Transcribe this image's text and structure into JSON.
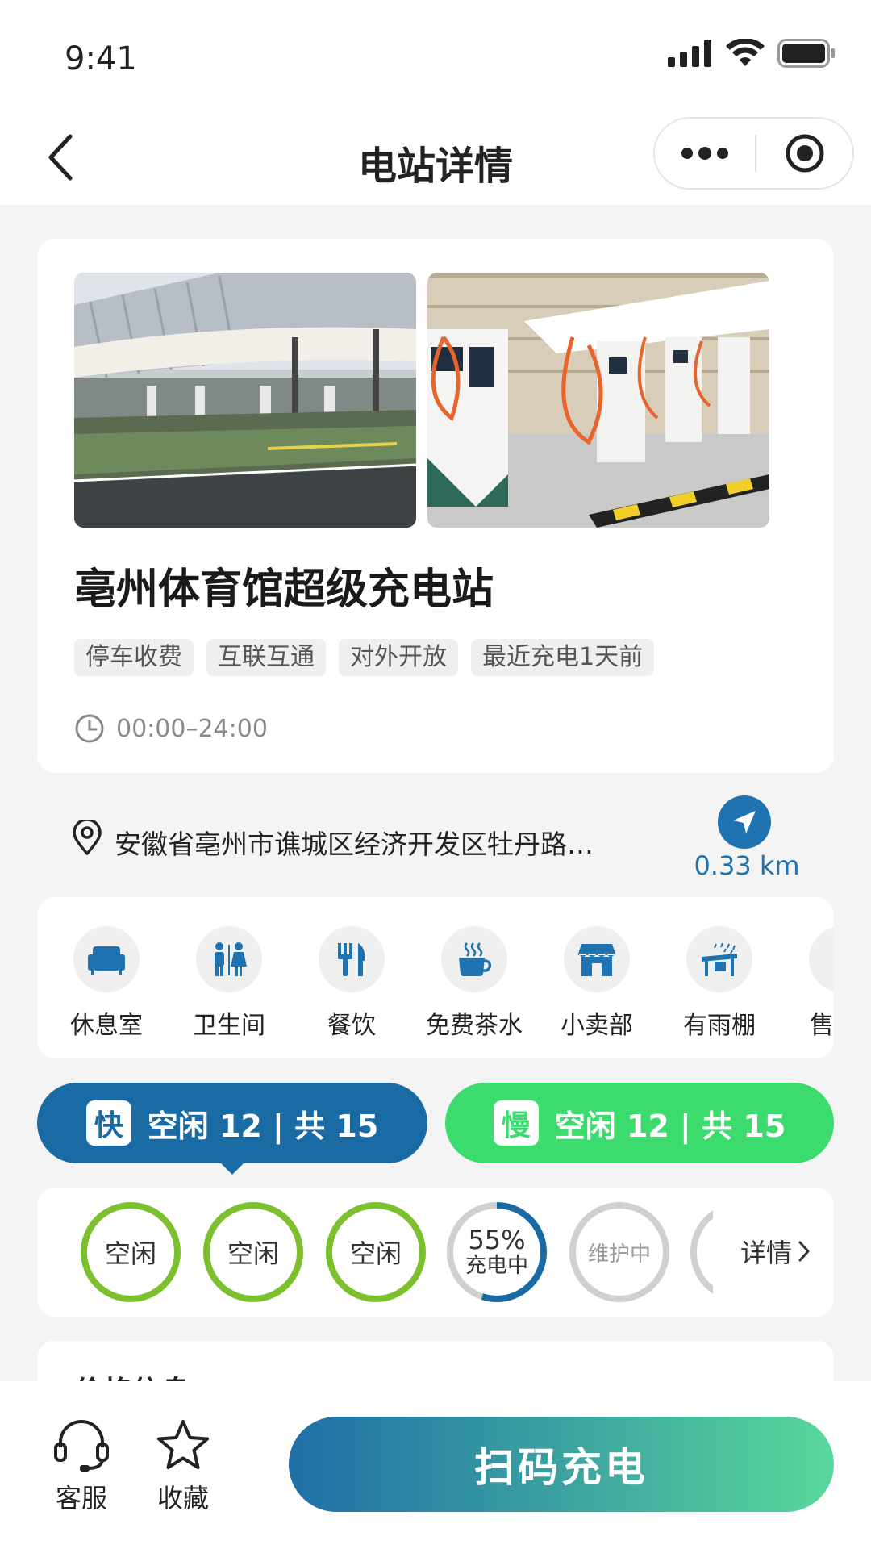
{
  "status_bar": {
    "time": "9:41"
  },
  "nav": {
    "title": "电站详情"
  },
  "station": {
    "name": "亳州体育馆超级充电站",
    "tags": [
      "停车收费",
      "互联互通",
      "对外开放",
      "最近充电1天前"
    ],
    "hours": "00:00–24:00",
    "address": "安徽省亳州市谯城区经济开发区牡丹路…",
    "distance": "0.33 km"
  },
  "amenities": [
    {
      "label": "休息室",
      "icon": "sofa-icon"
    },
    {
      "label": "卫生间",
      "icon": "restroom-icon"
    },
    {
      "label": "餐饮",
      "icon": "fork-knife-icon"
    },
    {
      "label": "免费茶水",
      "icon": "tea-cup-icon"
    },
    {
      "label": "小卖部",
      "icon": "shop-icon"
    },
    {
      "label": "有雨棚",
      "icon": "canopy-icon"
    },
    {
      "label": "售",
      "icon": "partial-icon"
    }
  ],
  "connectors": {
    "fast": {
      "badge": "快",
      "label": "空闲 12 | 共 15"
    },
    "slow": {
      "badge": "慢",
      "label": "空闲 12 | 共 15"
    }
  },
  "chargers": [
    {
      "status": "空闲"
    },
    {
      "status": "空闲"
    },
    {
      "status": "空闲"
    },
    {
      "status": "充电中",
      "percent": "55%",
      "progress": 0.55
    },
    {
      "status": "维护中"
    }
  ],
  "chargers_detail_link": "详情",
  "price": {
    "title": "价格信息"
  },
  "bottom_bar": {
    "service": "客服",
    "favorite": "收藏",
    "scan_button": "扫码充电"
  },
  "colors": {
    "primary_blue": "#1a6aa3",
    "green": "#3cdb6e",
    "idle_green": "#7cc02e"
  }
}
